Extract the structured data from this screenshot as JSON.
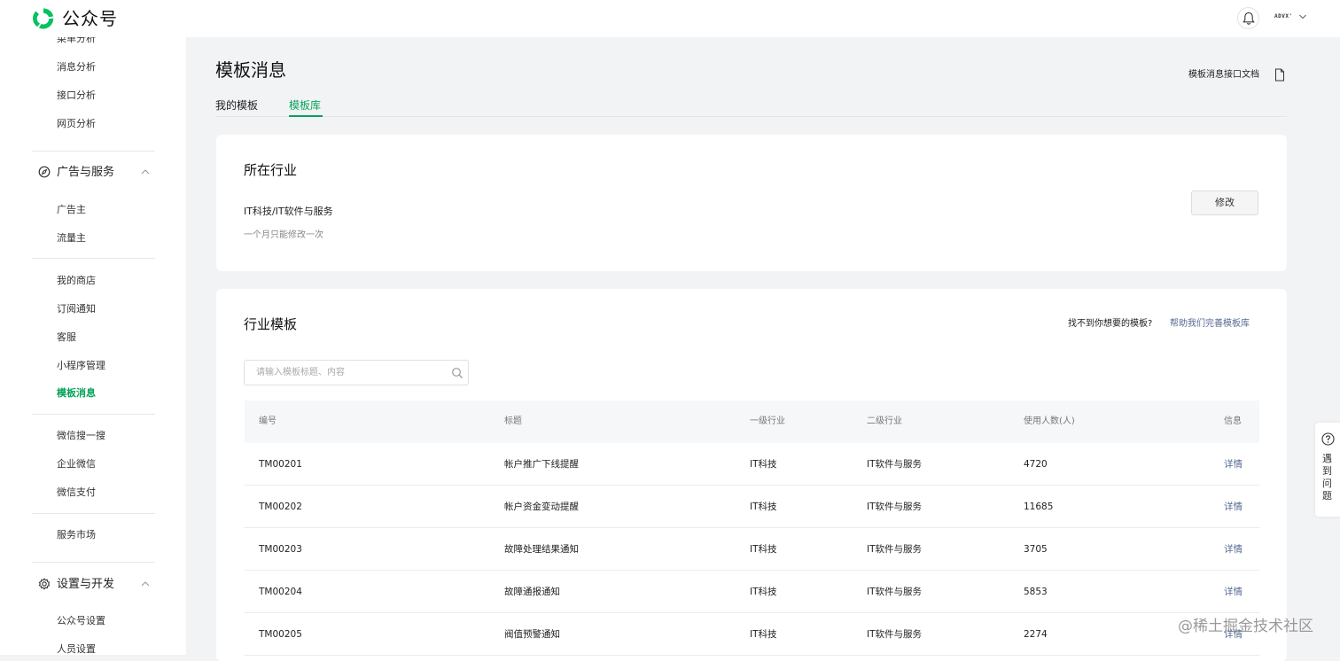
{
  "app": {
    "brand": "公众号"
  },
  "header": {
    "account_label": "ADVX'"
  },
  "sidebar": {
    "analysis_items": [
      {
        "label": "菜单分析"
      },
      {
        "label": "消息分析"
      },
      {
        "label": "接口分析"
      },
      {
        "label": "网页分析"
      }
    ],
    "ads_group": {
      "label": "广告与服务",
      "items": [
        {
          "label": "广告主"
        },
        {
          "label": "流量主"
        }
      ]
    },
    "service_items": [
      {
        "label": "我的商店"
      },
      {
        "label": "订阅通知"
      },
      {
        "label": "客服"
      },
      {
        "label": "小程序管理"
      },
      {
        "label": "模板消息"
      }
    ],
    "more_items": [
      {
        "label": "微信搜一搜"
      },
      {
        "label": "企业微信"
      },
      {
        "label": "微信支付"
      }
    ],
    "market_items": [
      {
        "label": "服务市场"
      }
    ],
    "settings_group": {
      "label": "设置与开发",
      "items": [
        {
          "label": "公众号设置"
        },
        {
          "label": "人员设置"
        }
      ]
    },
    "active_item": "模板消息"
  },
  "page": {
    "title": "模板消息",
    "doc_link": "模板消息接口文档",
    "tabs": [
      {
        "label": "我的模板"
      },
      {
        "label": "模板库"
      }
    ],
    "active_tab": "模板库"
  },
  "industry_card": {
    "title": "所在行业",
    "value": "IT科技/IT软件与服务",
    "note": "一个月只能修改一次",
    "edit_label": "修改"
  },
  "templates_card": {
    "title": "行业模板",
    "help_question": "找不到你想要的模板?",
    "help_link": "帮助我们完善模板库",
    "search": {
      "placeholder": "请输入模板标题、内容",
      "value": ""
    },
    "columns": [
      "编号",
      "标题",
      "一级行业",
      "二级行业",
      "使用人数(人)",
      "信息"
    ],
    "rows": [
      {
        "id": "TM00201",
        "title": "帐户推广下线提醒",
        "primary": "IT科技",
        "secondary": "IT软件与服务",
        "users": "4720",
        "action": "详情"
      },
      {
        "id": "TM00202",
        "title": "帐户资金变动提醒",
        "primary": "IT科技",
        "secondary": "IT软件与服务",
        "users": "11685",
        "action": "详情"
      },
      {
        "id": "TM00203",
        "title": "故障处理结果通知",
        "primary": "IT科技",
        "secondary": "IT软件与服务",
        "users": "3705",
        "action": "详情"
      },
      {
        "id": "TM00204",
        "title": "故障通报通知",
        "primary": "IT科技",
        "secondary": "IT软件与服务",
        "users": "5853",
        "action": "详情"
      },
      {
        "id": "TM00205",
        "title": "阀值预警通知",
        "primary": "IT科技",
        "secondary": "IT软件与服务",
        "users": "2274",
        "action": "详情"
      }
    ]
  },
  "help_widget": {
    "label": "遇到问题"
  },
  "watermark": "@稀土掘金技术社区",
  "colors": {
    "accent": "#07a35a",
    "link": "#576b95",
    "background": "#f2f3f5"
  }
}
